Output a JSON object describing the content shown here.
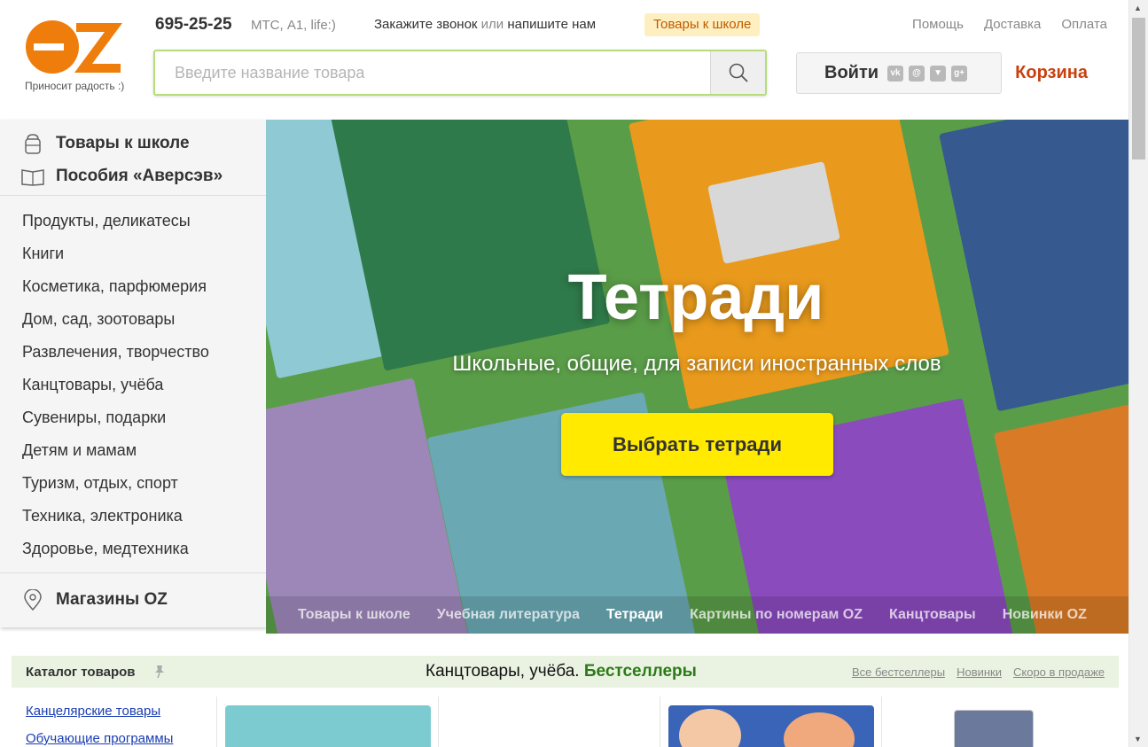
{
  "header": {
    "logo_text": "OZ",
    "logo_tagline": "Приносит радость :)",
    "phone": "695-25-25",
    "operators": "МТС, А1, life:)",
    "callback_part1": "Закажите звонок ",
    "callback_part2": "или",
    "callback_part3": " напишите нам",
    "school_chip": "Товары к школе",
    "toplinks": [
      "Помощь",
      "Доставка",
      "Оплата"
    ],
    "search_placeholder": "Введите название товара",
    "login_label": "Войти",
    "social_icons": [
      "vk-icon",
      "mail-icon",
      "ok-icon",
      "gplus-icon"
    ],
    "cart_label": "Корзина"
  },
  "sidebar": {
    "featured": [
      {
        "label": "Товары к школе",
        "icon": "backpack-icon"
      },
      {
        "label": "Пособия «Аверсэв»",
        "icon": "open-book-icon"
      }
    ],
    "items": [
      "Продукты, деликатесы",
      "Книги",
      "Косметика, парфюмерия",
      "Дом, сад, зоотовары",
      "Развлечения, творчество",
      "Канцтовары, учёба",
      "Сувениры, подарки",
      "Детям и мамам",
      "Туризм, отдых, спорт",
      "Техника, электроника",
      "Здоровье, медтехника"
    ],
    "stores": {
      "label": "Магазины OZ",
      "icon": "location-pin-icon"
    }
  },
  "hero": {
    "title": "Тетради",
    "subtitle": "Школьные, общие, для записи иностранных слов",
    "button": "Выбрать тетради",
    "tabs": [
      "Товары к школе",
      "Учебная литература",
      "Тетради",
      "Картины по номерам OZ",
      "Канцтовары",
      "Новинки OZ"
    ],
    "active_tab": "Тетради"
  },
  "catalog": {
    "label": "Каталог товаров",
    "links": [
      "Канцелярские товары",
      "Обучающие программы"
    ]
  },
  "bestsellers": {
    "title_part1": "Канцтовары, учёба. ",
    "title_part2": "Бестселлеры",
    "links": [
      "Все бестселлеры",
      "Новинки",
      "Скоро в продаже"
    ]
  },
  "colors": {
    "accent_orange": "#c9400f",
    "logo_orange": "#ef7d0c",
    "cta_yellow": "#ffea00",
    "bestseller_green": "#2b7a17",
    "link_blue": "#1a3db2"
  }
}
